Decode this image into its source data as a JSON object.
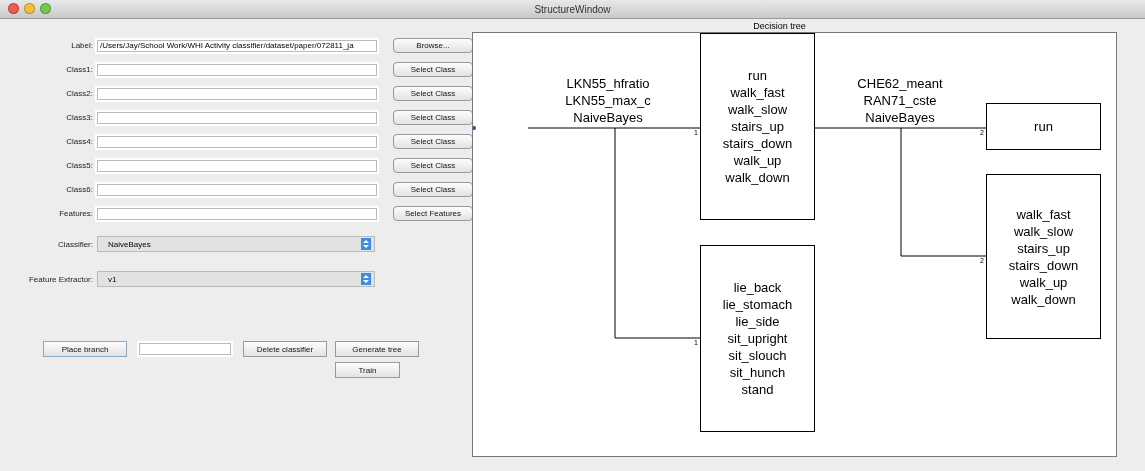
{
  "window": {
    "title": "StructureWindow"
  },
  "form": {
    "rows": [
      {
        "label": "Label:",
        "value": "/Users/Jay/School Work/WHI Activity classifier/dataset/paper/072811_ja",
        "button": "Browse..."
      },
      {
        "label": "Class1:",
        "value": "",
        "button": "Select Class"
      },
      {
        "label": "Class2:",
        "value": "",
        "button": "Select Class"
      },
      {
        "label": "Class3:",
        "value": "",
        "button": "Select Class"
      },
      {
        "label": "Class4:",
        "value": "",
        "button": "Select Class"
      },
      {
        "label": "Class5:",
        "value": "",
        "button": "Select Class"
      },
      {
        "label": "Class6:",
        "value": "",
        "button": "Select Class"
      },
      {
        "label": "Features:",
        "value": "",
        "button": "Select Features"
      }
    ],
    "selects": [
      {
        "label": "Classifier:",
        "value": "NaiveBayes"
      },
      {
        "label": "Feature Extractor:",
        "value": "v1"
      }
    ],
    "actions": {
      "place_branch": "Place branch",
      "delete_classifier": "Delete classifier",
      "generate_tree": "Generate tree",
      "train": "Train"
    }
  },
  "decision_tree": {
    "title": "Decision tree",
    "nodes": [
      {
        "kind": "classifier",
        "lines": [
          "LKN55_hfratio",
          "LKN55_max_c",
          "NaiveBayes"
        ]
      },
      {
        "kind": "leaf",
        "branch": "1",
        "lines": [
          "run",
          "walk_fast",
          "walk_slow",
          "stairs_up",
          "stairs_down",
          "walk_up",
          "walk_down"
        ]
      },
      {
        "kind": "leaf",
        "branch": "1",
        "lines": [
          "lie_back",
          "lie_stomach",
          "lie_side",
          "sit_upright",
          "sit_slouch",
          "sit_hunch",
          "stand"
        ]
      },
      {
        "kind": "classifier",
        "lines": [
          "CHE62_meant",
          "RAN71_cste",
          "NaiveBayes"
        ]
      },
      {
        "kind": "leaf",
        "branch": "2",
        "lines": [
          "run"
        ]
      },
      {
        "kind": "leaf",
        "branch": "2",
        "lines": [
          "walk_fast",
          "walk_slow",
          "stairs_up",
          "stairs_down",
          "walk_up",
          "walk_down"
        ]
      }
    ]
  }
}
